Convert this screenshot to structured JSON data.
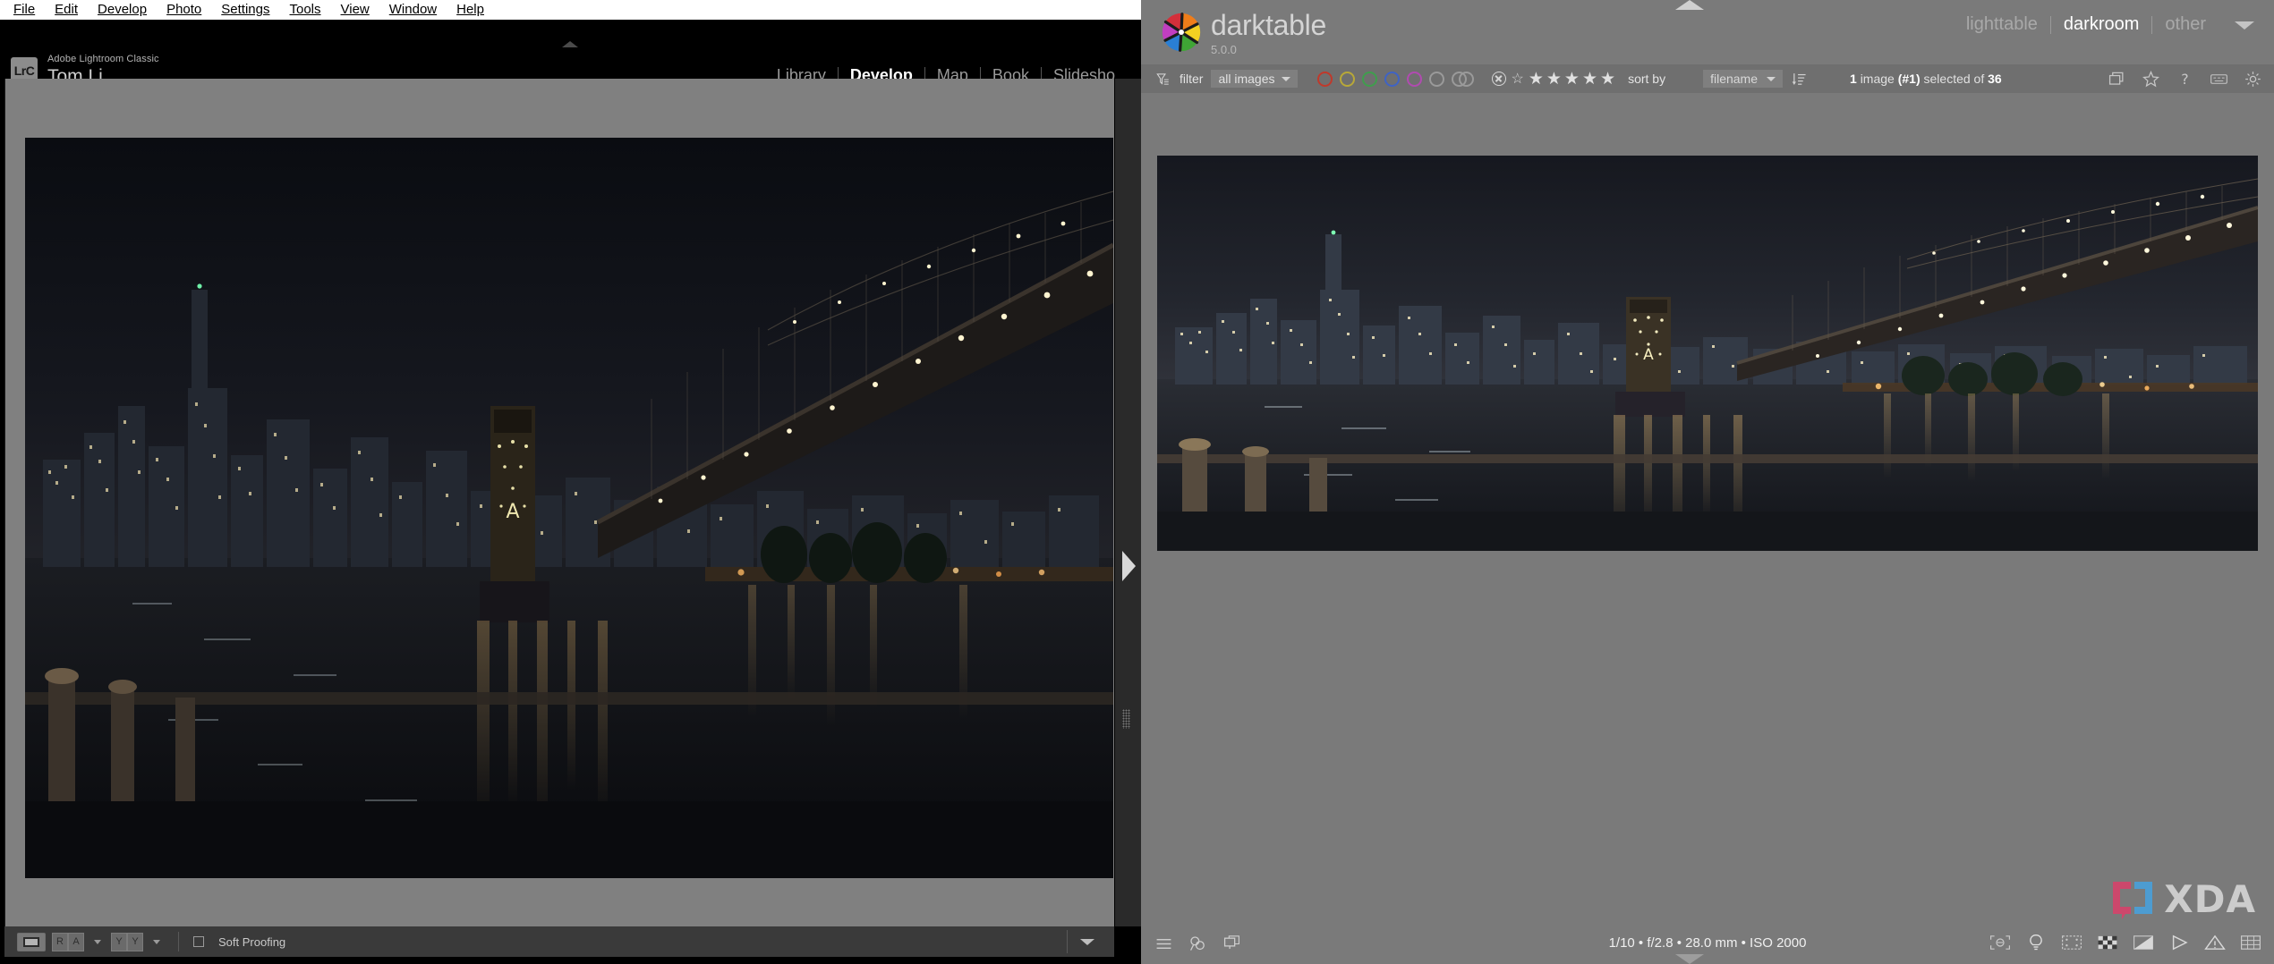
{
  "lightroom": {
    "menubar": [
      "File",
      "Edit",
      "Develop",
      "Photo",
      "Settings",
      "Tools",
      "View",
      "Window",
      "Help"
    ],
    "identity": {
      "app": "Adobe Lightroom Classic",
      "user": "Tom Li",
      "badge": "LrC"
    },
    "modules": [
      "Library",
      "Develop",
      "Map",
      "Book",
      "Slidesho"
    ],
    "active_module": "Develop",
    "toolbar": {
      "view_loupe": "loupe-view",
      "before_after": [
        "R",
        "A"
      ],
      "compare": [
        "Y",
        "Y"
      ],
      "soft_proofing_label": "Soft Proofing"
    }
  },
  "darktable": {
    "brand": {
      "name": "darktable",
      "version": "5.0.0"
    },
    "views": [
      "lighttable",
      "darkroom",
      "other"
    ],
    "active_view": "darkroom",
    "filterbar": {
      "filter_label": "filter",
      "filter_value": "all images",
      "sort_label": "sort by",
      "sort_value": "filename",
      "selection": {
        "count": "1",
        "word_image": "image",
        "index": "(#1)",
        "word_selected": "selected of",
        "total": "36"
      },
      "color_labels": [
        {
          "name": "red",
          "hex": "#c0392b"
        },
        {
          "name": "yellow",
          "hex": "#b8a838"
        },
        {
          "name": "green",
          "hex": "#3f9e4d"
        },
        {
          "name": "blue",
          "hex": "#3f63c4"
        },
        {
          "name": "purple",
          "hex": "#b04bb0"
        },
        {
          "name": "gray",
          "hex": "#9a9a9a"
        },
        {
          "name": "split",
          "hex": "#9a9a9a"
        }
      ],
      "star_count": 5
    },
    "header_icons": [
      "grouping-icon",
      "overlays-star-icon",
      "help-icon",
      "shortcuts-keyboard-icon",
      "preferences-gear-icon"
    ],
    "footer_icons": [
      "hamburger-menu-icon",
      "color-picker-icon",
      "second-window-icon"
    ],
    "exif": "1/10 • f/2.8 • 28.0 mm • ISO 2000",
    "right_footer_icons": [
      "focus-peaking-icon",
      "lighting-bulb-icon",
      "crop-guides-icon",
      "clipping-checker-icon",
      "gamut-check-icon",
      "raw-overexposed-icon",
      "overexposed-warning-icon",
      "grid-overlay-icon"
    ]
  },
  "watermark": {
    "text": "XDA",
    "mark_colors": {
      "pink": "#d3456b",
      "blue": "#4a9fd8"
    }
  },
  "photo": {
    "subject": "Brooklyn Bridge at night over East River with Lower Manhattan skyline",
    "sky": "#14161c",
    "water": "#0e1014"
  }
}
